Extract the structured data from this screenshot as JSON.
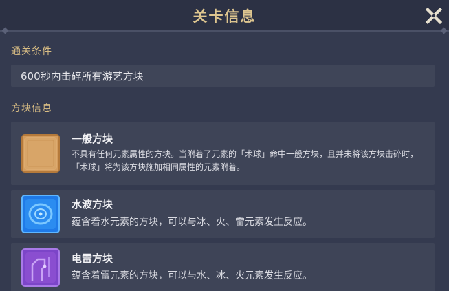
{
  "header": {
    "title": "关卡信息"
  },
  "icons": {
    "close": "close-icon",
    "ordinary_block": "ordinary-block-icon",
    "hydro_block": "hydro-block-icon",
    "electro_block": "electro-block-icon"
  },
  "colors": {
    "accent_gold": "#d9bd84",
    "panel_bg": "#343a4f",
    "card_bg": "#3e4457",
    "ordinary": "#d59a5a",
    "hydro": "#2b8cf0",
    "electro": "#8a4ed0"
  },
  "clear_condition": {
    "label": "通关条件",
    "text": "600秒内击碎所有游艺方块"
  },
  "block_info": {
    "label": "方块信息",
    "blocks": [
      {
        "name": "一般方块",
        "description": "不具有任何元素属性的方块。当附着了元素的「术球」命中一般方块，且并未将该方块击碎时，「术球」将为该方块施加相同属性的元素附着。"
      },
      {
        "name": "水波方块",
        "description": "蕴含着水元素的方块，可以与冰、火、雷元素发生反应。"
      },
      {
        "name": "电雷方块",
        "description": "蕴含着雷元素的方块，可以与水、冰、火元素发生反应。"
      }
    ]
  }
}
